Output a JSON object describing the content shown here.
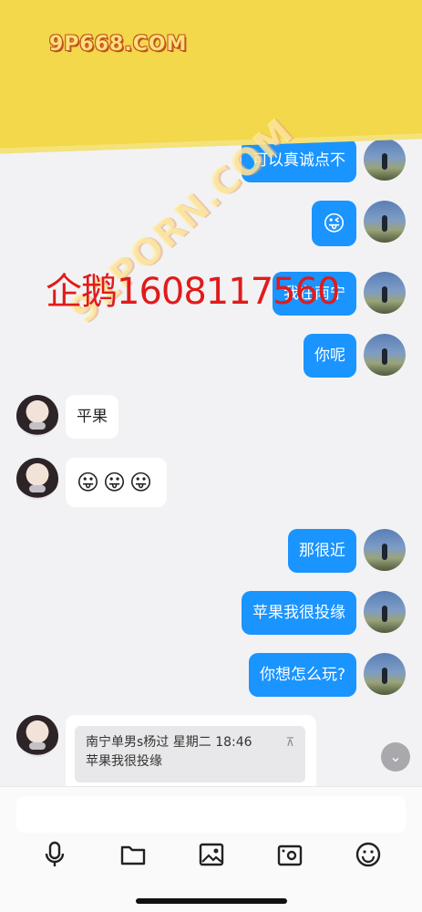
{
  "messages": [
    {
      "side": "me",
      "text": "可以真诚点不"
    },
    {
      "side": "me",
      "text": "😜"
    },
    {
      "side": "me",
      "text": "我在南宁"
    },
    {
      "side": "me",
      "text": "你呢"
    },
    {
      "side": "other",
      "text": "平果"
    },
    {
      "side": "other",
      "text": "😛😛😛"
    },
    {
      "side": "me",
      "text": "那很近"
    },
    {
      "side": "me",
      "text": "苹果我很投缘"
    },
    {
      "side": "me",
      "text": "你想怎么玩?"
    }
  ],
  "quote": {
    "header": "南宁单男s杨过  星期二 18:46",
    "body": "苹果我很投缘",
    "pin_icon": "⊼"
  },
  "scroll_down_icon": "⌄",
  "composer": {
    "placeholder": "",
    "tools": [
      "microphone-icon",
      "folder-icon",
      "image-icon",
      "camera-icon",
      "emoji-icon"
    ]
  },
  "watermark": {
    "brand": "9P668.COM",
    "diagonal": "91PORN.COM",
    "contact": "企鹅1608117560"
  },
  "colors": {
    "bubble_me": "#1a94ff",
    "bubble_other": "#ffffff",
    "banner": "#f2d84a",
    "contact_red": "#e01b1b"
  }
}
